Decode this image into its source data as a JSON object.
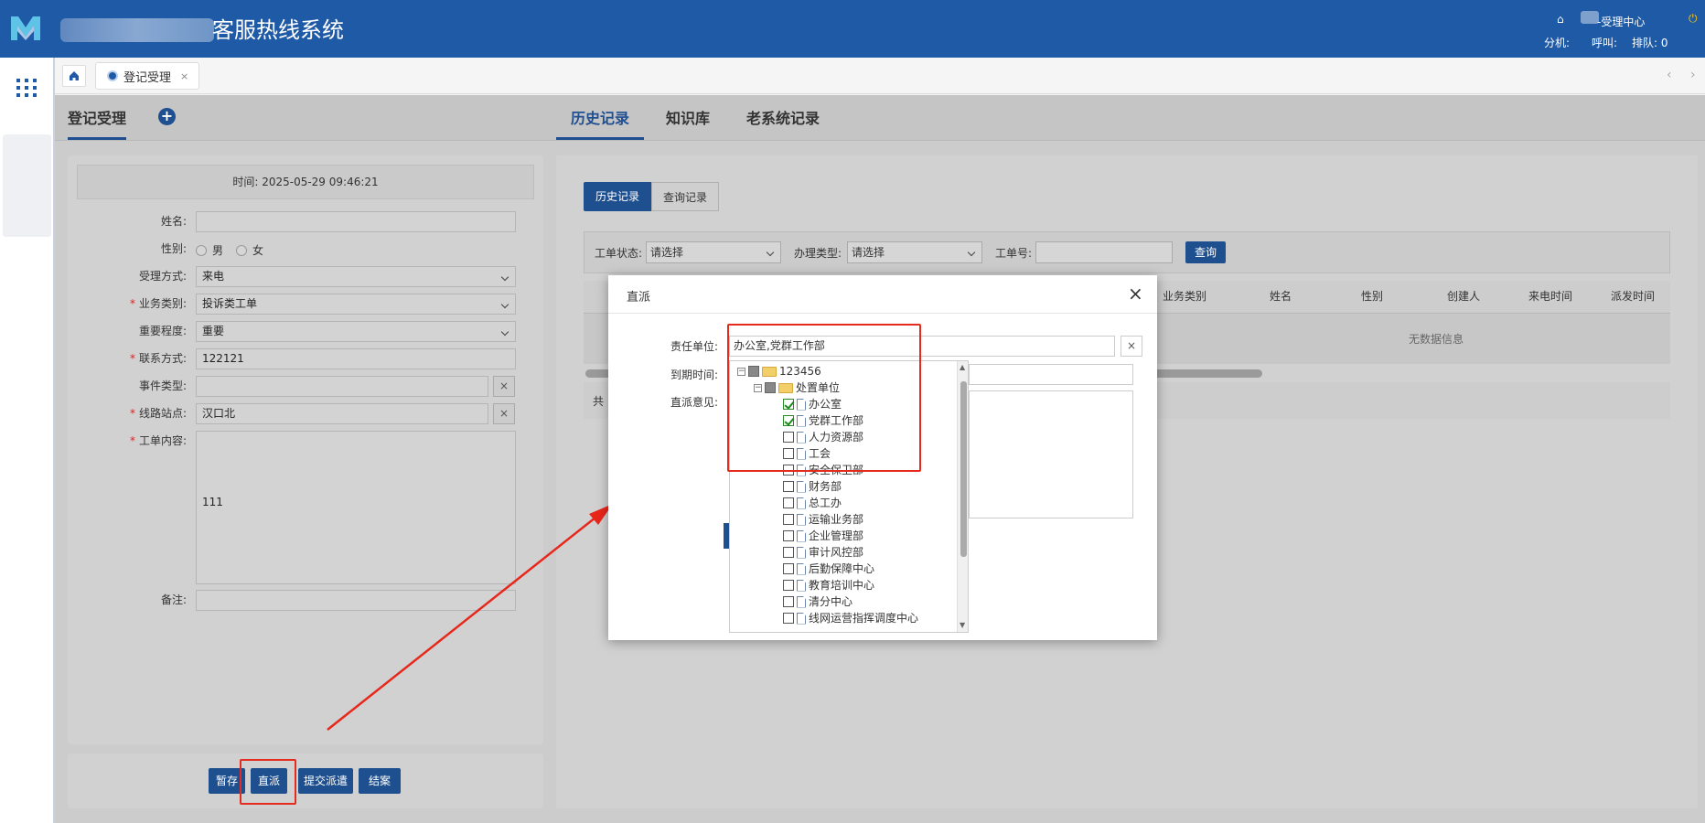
{
  "app": {
    "title": "客服热线系统",
    "user_label": "-受理中心",
    "extension_label": "分机:",
    "call_label": "呼叫:",
    "queue_label": "排队: 0"
  },
  "tabs": [
    {
      "label": "登记受理",
      "close": "×"
    }
  ],
  "left_panel": {
    "title": "登记受理",
    "time_text": "时间: 2025-05-29 09:46:21",
    "fields": {
      "name_label": "姓名:",
      "gender_label": "性别:",
      "gender_options": [
        "男",
        "女"
      ],
      "method_label": "受理方式:",
      "method_value": "来电",
      "category_label": "业务类别:",
      "category_value": "投诉类工单",
      "priority_label": "重要程度:",
      "priority_value": "重要",
      "contact_label": "联系方式:",
      "contact_value": "122121",
      "event_type_label": "事件类型:",
      "station_label": "线路站点:",
      "station_value": "汉口北",
      "content_label": "工单内容:",
      "content_value": "111",
      "remark_label": "备注:",
      "clear": "×"
    },
    "actions": [
      "暂存",
      "直派",
      "提交派遣",
      "结案"
    ]
  },
  "right_panel": {
    "tabs": [
      "历史记录",
      "知识库",
      "老系统记录"
    ],
    "subtabs": [
      "历史记录",
      "查询记录"
    ],
    "filters": {
      "status_label": "工单状态:",
      "status_value": "请选择",
      "type_label": "办理类型:",
      "type_value": "请选择",
      "no_label": "工单号:",
      "query_button": "查询"
    },
    "columns": [
      "业务类别",
      "姓名",
      "性别",
      "创建人",
      "来电时间",
      "派发时间"
    ],
    "empty_text": "无数据信息",
    "total_prefix": "共"
  },
  "modal": {
    "title": "直派",
    "close": "×",
    "unit_label": "责任单位:",
    "unit_value": "办公室,党群工作部",
    "due_label": "到期时间:",
    "opinion_label": "直派意见:",
    "clear": "×",
    "tree": {
      "root": "123456",
      "group": "处置单位",
      "items": [
        {
          "label": "办公室",
          "checked": true
        },
        {
          "label": "党群工作部",
          "checked": true
        },
        {
          "label": "人力资源部",
          "checked": false
        },
        {
          "label": "工会",
          "checked": false
        },
        {
          "label": "安全保卫部",
          "checked": false
        },
        {
          "label": "财务部",
          "checked": false
        },
        {
          "label": "总工办",
          "checked": false
        },
        {
          "label": "运输业务部",
          "checked": false
        },
        {
          "label": "企业管理部",
          "checked": false
        },
        {
          "label": "审计风控部",
          "checked": false
        },
        {
          "label": "后勤保障中心",
          "checked": false
        },
        {
          "label": "教育培训中心",
          "checked": false
        },
        {
          "label": "清分中心",
          "checked": false
        },
        {
          "label": "线网运营指挥调度中心",
          "checked": false
        }
      ]
    }
  }
}
